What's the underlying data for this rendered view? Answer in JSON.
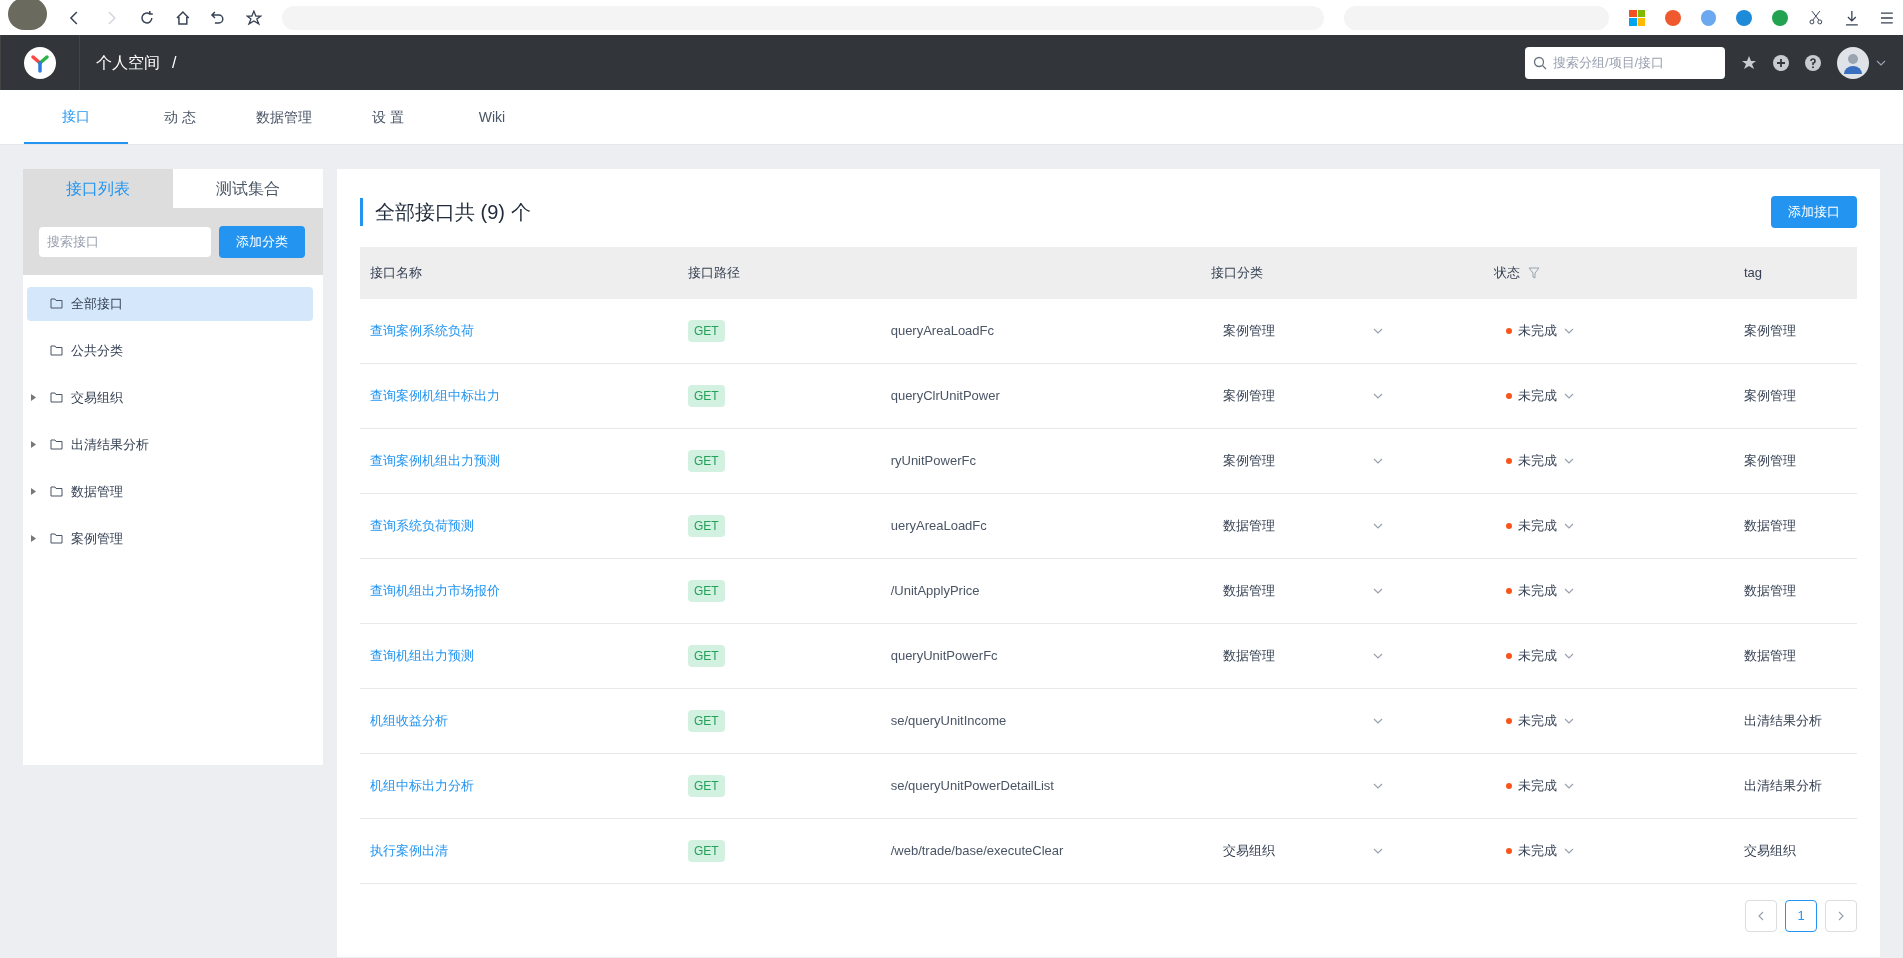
{
  "header": {
    "breadcrumb": "个人空间",
    "separator": "/",
    "search": {
      "placeholder": "搜索分组/项目/接口"
    }
  },
  "nav_tabs": [
    {
      "label": "接口",
      "selected": true
    },
    {
      "label": "动 态",
      "selected": false
    },
    {
      "label": "数据管理",
      "selected": false
    },
    {
      "label": "设 置",
      "selected": false
    },
    {
      "label": "Wiki",
      "selected": false
    }
  ],
  "sidebar": {
    "tabs": [
      {
        "label": "接口列表",
        "selected": true
      },
      {
        "label": "测试集合",
        "selected": false
      }
    ],
    "search": {
      "placeholder": "搜索接口"
    },
    "add_button": "添加分类",
    "items": [
      {
        "label": "全部接口",
        "selected": true,
        "expandable": false
      },
      {
        "label": "公共分类",
        "selected": false,
        "expandable": false
      },
      {
        "label": "交易组织",
        "selected": false,
        "expandable": true
      },
      {
        "label": "出清结果分析",
        "selected": false,
        "expandable": true
      },
      {
        "label": "数据管理",
        "selected": false,
        "expandable": true
      },
      {
        "label": "案例管理",
        "selected": false,
        "expandable": true
      }
    ]
  },
  "main": {
    "title": "全部接口共 (9) 个",
    "add_button": "添加接口",
    "table": {
      "columns": [
        "接口名称",
        "接口路径",
        "接口分类",
        "状态",
        "tag"
      ],
      "rows": [
        {
          "name": "查询案例系统负荷",
          "method": "GET",
          "path": "queryAreaLoadFc",
          "category": "案例管理",
          "status": "未完成",
          "color": "#fa541c",
          "tag": "案例管理"
        },
        {
          "name": "查询案例机组中标出力",
          "method": "GET",
          "path": "queryClrUnitPower",
          "category": "案例管理",
          "status": "未完成",
          "color": "#fa541c",
          "tag": "案例管理"
        },
        {
          "name": "查询案例机组出力预测",
          "method": "GET",
          "path": "ryUnitPowerFc",
          "category": "案例管理",
          "status": "未完成",
          "color": "#fa541c",
          "tag": "案例管理"
        },
        {
          "name": "查询系统负荷预测",
          "method": "GET",
          "path": "ueryAreaLoadFc",
          "category": "数据管理",
          "status": "未完成",
          "color": "#fa541c",
          "tag": "数据管理"
        },
        {
          "name": "查询机组出力市场报价",
          "method": "GET",
          "path": "/UnitApplyPrice",
          "category": "数据管理",
          "status": "未完成",
          "color": "#fa541c",
          "tag": "数据管理"
        },
        {
          "name": "查询机组出力预测",
          "method": "GET",
          "path": "queryUnitPowerFc",
          "category": "数据管理",
          "status": "未完成",
          "color": "#fa541c",
          "tag": "数据管理"
        },
        {
          "name": "机组收益分析",
          "method": "GET",
          "path": "se/queryUnitIncome",
          "status": "未完成",
          "color": "#fa541c",
          "tag": "出清结果分析"
        },
        {
          "name": "机组中标出力分析",
          "method": "GET",
          "path": "se/queryUnitPowerDetailList",
          "status": "未完成",
          "color": "#fa541c",
          "tag": "出清结果分析"
        },
        {
          "name": "执行案例出清",
          "method": "GET",
          "path": "/web/trade/base/executeClear",
          "category": "交易组织",
          "status": "未完成",
          "color": "#fa541c",
          "tag": "交易组织"
        }
      ]
    },
    "pagination": [
      {
        "label": "1",
        "selected": true
      }
    ]
  }
}
